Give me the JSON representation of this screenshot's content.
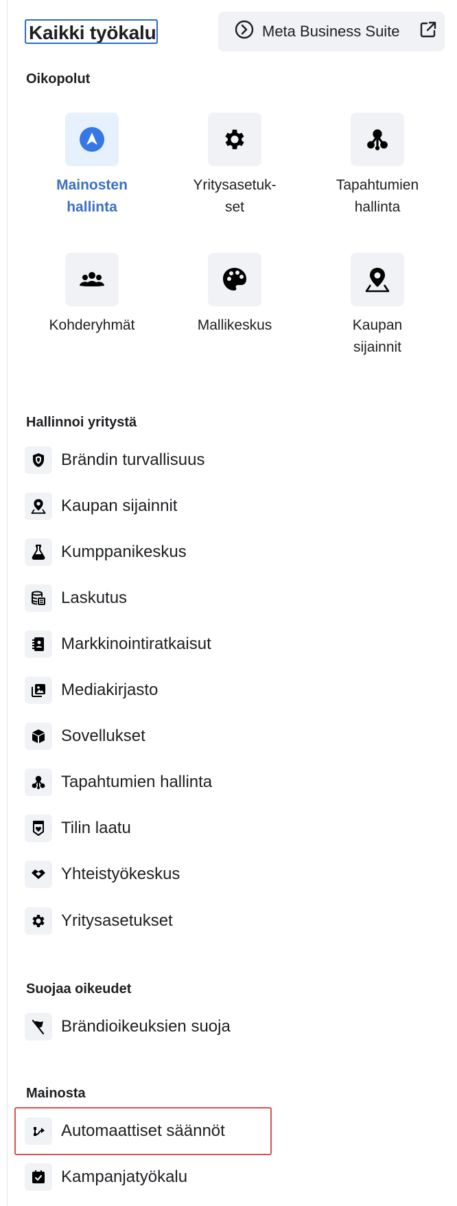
{
  "header": {
    "title": "Kaikki työkalut",
    "meta_button": "Meta Business Suite"
  },
  "shortcuts": {
    "heading": "Oikopolut",
    "items": [
      {
        "label_line1": "Mainosten",
        "label_line2": "hallinta",
        "icon": "ads-manager-icon",
        "active": true
      },
      {
        "label_line1": "Yritysasetuk-",
        "label_line2": "set",
        "icon": "gear-icon",
        "active": false
      },
      {
        "label_line1": "Tapahtumien",
        "label_line2": "hallinta",
        "icon": "events-manager-icon",
        "active": false
      },
      {
        "label_line1": "Kohderyhmät",
        "label_line2": "",
        "icon": "audiences-icon",
        "active": false
      },
      {
        "label_line1": "Mallikeskus",
        "label_line2": "",
        "icon": "palette-icon",
        "active": false
      },
      {
        "label_line1": "Kaupan",
        "label_line2": "sijainnit",
        "icon": "store-location-icon",
        "active": false
      }
    ]
  },
  "manage_business": {
    "heading": "Hallinnoi yritystä",
    "items": [
      {
        "label": "Brändin turvallisuus",
        "icon": "shield-icon"
      },
      {
        "label": "Kaupan sijainnit",
        "icon": "store-location-icon"
      },
      {
        "label": "Kumppanikeskus",
        "icon": "flask-icon"
      },
      {
        "label": "Laskutus",
        "icon": "billing-icon"
      },
      {
        "label": "Markkinointiratkaisut",
        "icon": "contacts-book-icon"
      },
      {
        "label": "Mediakirjasto",
        "icon": "media-library-icon"
      },
      {
        "label": "Sovellukset",
        "icon": "cube-icon"
      },
      {
        "label": "Tapahtumien hallinta",
        "icon": "events-manager-icon"
      },
      {
        "label": "Tilin laatu",
        "icon": "account-quality-icon"
      },
      {
        "label": "Yhteistyökeskus",
        "icon": "handshake-icon"
      },
      {
        "label": "Yritysasetukset",
        "icon": "gear-icon"
      }
    ]
  },
  "protect_rights": {
    "heading": "Suojaa oikeudet",
    "items": [
      {
        "label": "Brändioikeuksien suoja",
        "icon": "flag-icon"
      }
    ]
  },
  "advertise": {
    "heading": "Mainosta",
    "items": [
      {
        "label": "Automaattiset säännöt",
        "icon": "automated-rules-icon"
      },
      {
        "label": "Kampanjatyökalu",
        "icon": "campaign-planner-icon"
      }
    ]
  },
  "colors": {
    "accent": "#3b6fc6",
    "tile_bg": "#f0f2f5",
    "highlight": "#d9534f"
  }
}
